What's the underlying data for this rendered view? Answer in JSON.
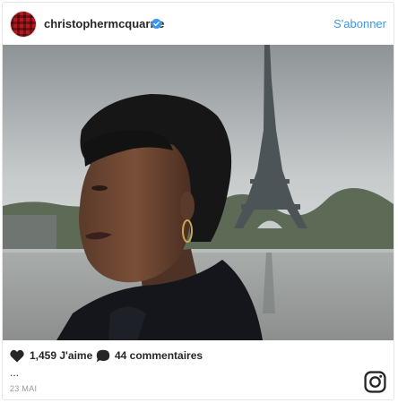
{
  "header": {
    "username": "christophermcquarrie",
    "follow_label": "S'abonner",
    "avatar_icon": "plaid-avatar",
    "verified_icon": "verified-badge-icon",
    "verified_color": "#3897f0"
  },
  "post": {
    "image_alt": "Portrait of a woman with short dark hair in front of the Eiffel Tower",
    "likes_label": "1,459 J'aime",
    "comments_label": "44 commentaires",
    "more_label": "...",
    "date_label": "23 MAI"
  },
  "icons": {
    "like": "heart-icon",
    "comment": "speech-bubble-icon",
    "brand": "instagram-logo-icon"
  },
  "colors": {
    "accent": "#3897f0",
    "text": "#262626",
    "muted": "#999999",
    "border": "#e6e6e6"
  }
}
